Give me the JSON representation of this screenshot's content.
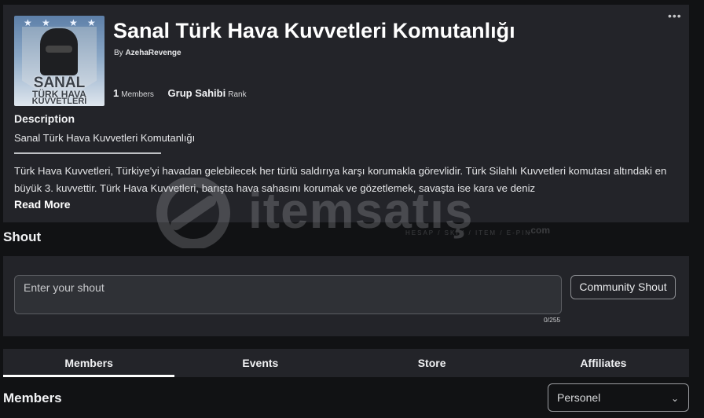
{
  "group": {
    "title": "Sanal Türk Hava Kuvvetleri Komutanlığı",
    "by_prefix": "By",
    "owner": "AzehaRevenge",
    "member_count": "1",
    "members_label": "Members",
    "rank_name": "Grup Sahibi",
    "rank_label": "Rank",
    "more_icon": "more-horizontal-icon"
  },
  "logo": {
    "line1": "SANAL",
    "line2": "TÜRK HAVA",
    "line3": "KUVVETLERİ"
  },
  "description": {
    "heading": "Description",
    "line1": "Sanal Türk Hava Kuvvetleri Komutanlığı",
    "body": "Türk Hava Kuvvetleri, Türkiye'yi havadan gelebilecek her türlü saldırıya karşı korumakla görevlidir. Türk Silahlı Kuvvetleri komutası altındaki en büyük 3. kuvvettir. Türk Hava Kuvvetleri, barışta hava sahasını korumak ve gözetlemek, savaşta ise kara ve deniz",
    "read_more": "Read More"
  },
  "shout": {
    "heading": "Shout",
    "placeholder": "Enter your shout",
    "counter": "0/255",
    "button": "Community Shout"
  },
  "tabs": [
    {
      "label": "Members",
      "active": true
    },
    {
      "label": "Events",
      "active": false
    },
    {
      "label": "Store",
      "active": false
    },
    {
      "label": "Affiliates",
      "active": false
    }
  ],
  "members_section": {
    "heading": "Members",
    "role_selected": "Personel"
  },
  "watermark": {
    "brand": "itemsatış",
    "tagline": "HESAP / SKIN / ITEM / E-PIN",
    "suffix": ".com"
  },
  "colors": {
    "background": "#111214",
    "card": "#232429",
    "input": "#2f3136",
    "text": "#f2f3f5"
  }
}
